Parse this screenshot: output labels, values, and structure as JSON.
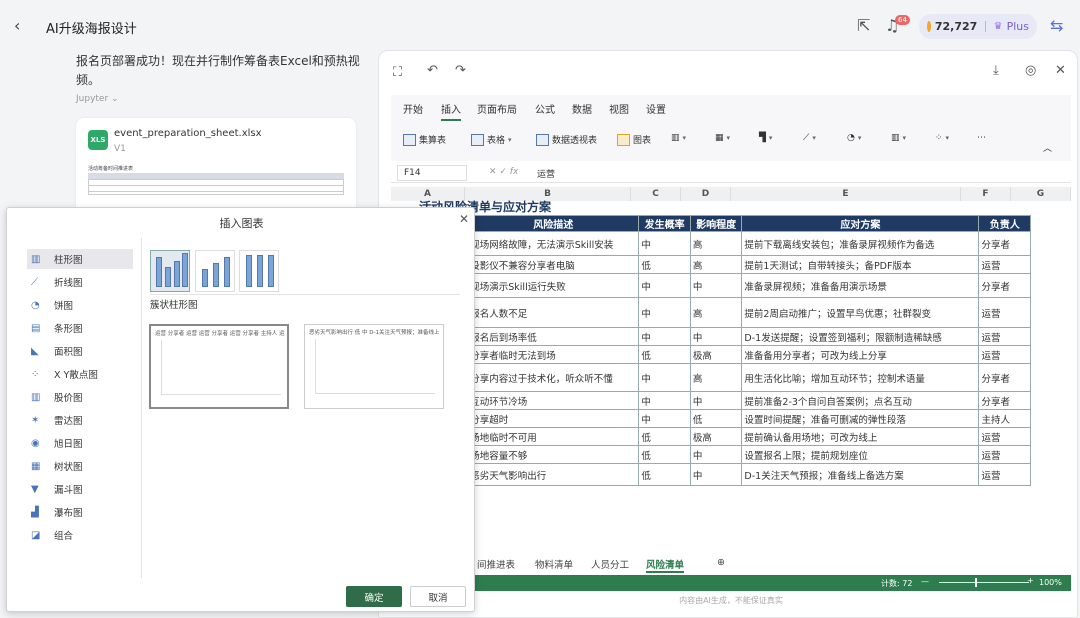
{
  "app": {
    "title": "AI升级海报设计",
    "credits": "72,727",
    "plan": "Plus",
    "badge": "64"
  },
  "chat": {
    "message": "报名页部署成功！现在并行制作筹备表Excel和预热视频。",
    "tool": "Jupyter",
    "file": {
      "type": "XLS",
      "name": "event_preparation_sheet.xlsx",
      "version": "V1",
      "preview_title": "活动筹备时间推进表"
    }
  },
  "excel": {
    "menus": [
      "开始",
      "插入",
      "页面布局",
      "公式",
      "数据",
      "视图",
      "设置"
    ],
    "active_menu": "插入",
    "ribbon": [
      "集算表",
      "表格",
      "数据透视表",
      "图表"
    ],
    "cell_ref": "F14",
    "formula_value": "运营",
    "columns": [
      "A",
      "B",
      "C",
      "D",
      "E",
      "F",
      "G"
    ],
    "sheet_title": "活动风险清单与应对方案",
    "headers": [
      "风险描述",
      "发生概率",
      "影响程度",
      "应对方案",
      "负责人"
    ],
    "rows": [
      [
        "现场网络故障，无法演示Skill安装",
        "中",
        "高",
        "提前下载离线安装包；准备录屏视频作为备选",
        "分享者"
      ],
      [
        "投影仪不兼容分享者电脑",
        "低",
        "高",
        "提前1天测试；自带转接头；备PDF版本",
        "运营"
      ],
      [
        "现场演示Skill运行失败",
        "中",
        "中",
        "准备录屏视频；准备备用演示场景",
        "分享者"
      ],
      [
        "报名人数不足",
        "中",
        "高",
        "提前2周启动推广；设置早鸟优惠；社群裂变",
        "运营"
      ],
      [
        "报名后到场率低",
        "中",
        "中",
        "D-1发送提醒；设置签到福利；限额制造稀缺感",
        "运营"
      ],
      [
        "分享者临时无法到场",
        "低",
        "极高",
        "准备备用分享者；可改为线上分享",
        "运营"
      ],
      [
        "分享内容过于技术化，听众听不懂",
        "中",
        "高",
        "用生活化比喻；增加互动环节；控制术语量",
        "分享者"
      ],
      [
        "互动环节冷场",
        "中",
        "中",
        "提前准备2-3个自问自答案例；点名互动",
        "分享者"
      ],
      [
        "分享超时",
        "中",
        "低",
        "设置时间提醒；准备可删减的弹性段落",
        "主持人"
      ],
      [
        "场地临时不可用",
        "低",
        "极高",
        "提前确认备用场地；可改为线上",
        "运营"
      ],
      [
        "场地容量不够",
        "低",
        "中",
        "设置报名上限；提前规划座位",
        "运营"
      ],
      [
        "恶劣天气影响出行",
        "低",
        "中",
        "D-1关注天气预报；准备线上备选方案",
        "运营"
      ]
    ],
    "tabs": [
      "间推进表",
      "物料清单",
      "人员分工",
      "风险清单"
    ],
    "active_tab": "风险清单",
    "status_count": "计数: 72",
    "zoom": "100%",
    "disclaimer": "内容由AI生成，不能保证真实"
  },
  "dialog": {
    "title": "插入图表",
    "types": [
      "柱形图",
      "折线图",
      "饼图",
      "条形图",
      "面积图",
      "X Y散点图",
      "股价图",
      "雷达图",
      "旭日图",
      "树状图",
      "漏斗图",
      "瀑布图",
      "组合"
    ],
    "selected_type": "柱形图",
    "subtype_name": "簇状柱形图",
    "preview1_legend": "运营 分享者 运营 运营 分享者 运营 分享者 主持人 运营 运",
    "preview2_legend": "恶劣天气影响出行 低 中 D-1关注天气预报；准备线上备选方",
    "ok": "确定",
    "cancel": "取消"
  }
}
